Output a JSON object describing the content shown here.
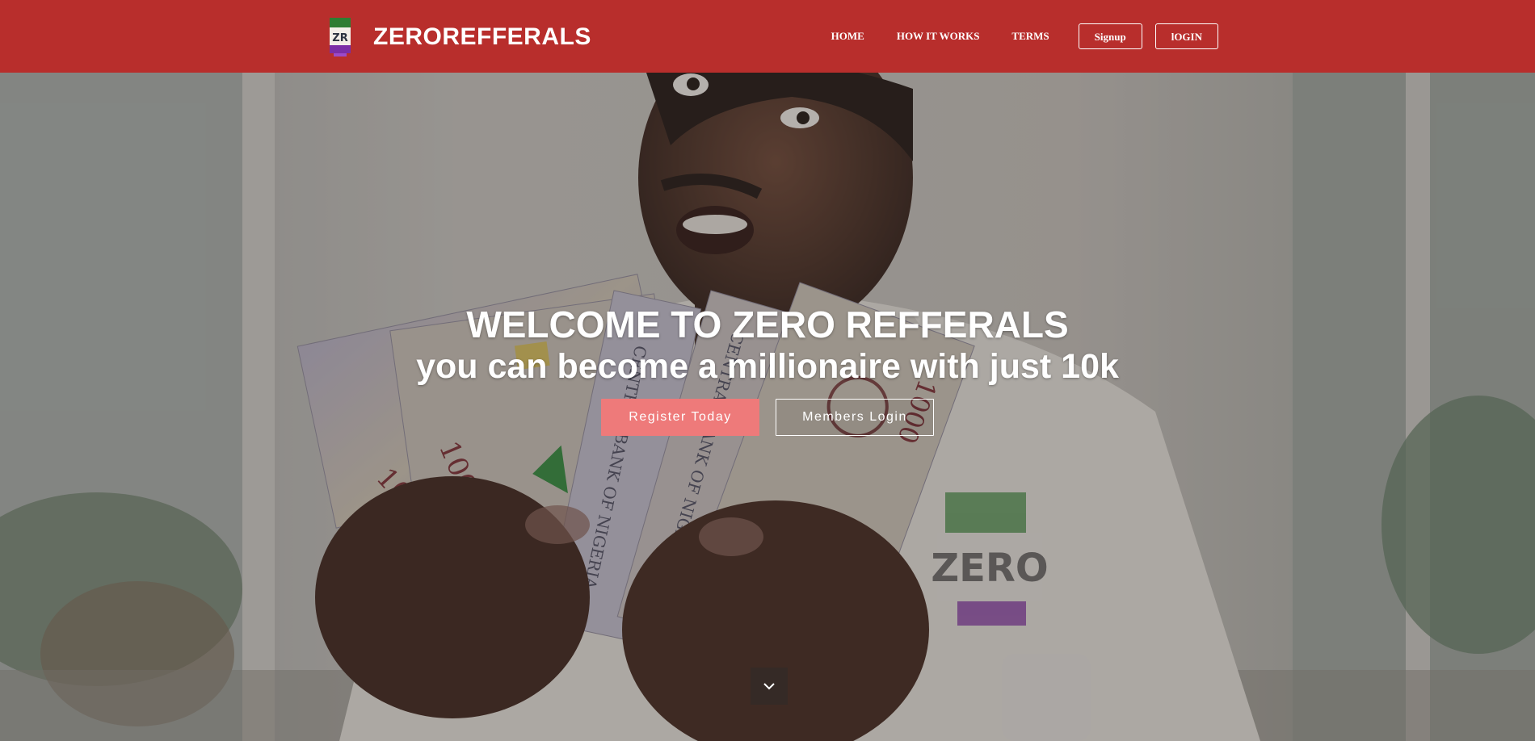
{
  "navbar": {
    "brand_name": "ZEROREFFERALS",
    "logo_icon": "zero-referrals-logo",
    "links": [
      {
        "label": "HOME"
      },
      {
        "label": "HOW IT WORKS"
      },
      {
        "label": "TERMS"
      }
    ],
    "signup_label": "Signup",
    "login_label": "lOGIN"
  },
  "hero": {
    "title": "WELCOME TO ZERO REFFERALS",
    "subtitle": "you can become a millionaire with just 10k",
    "register_label": "Register Today",
    "members_login_label": "Members Login",
    "scroll_icon": "chevron-down-icon",
    "background_description_icon": "hero-photo"
  },
  "colors": {
    "navbar_bg": "#b82e2c",
    "register_button_bg": "#ee7a7a",
    "text": "#ffffff"
  }
}
